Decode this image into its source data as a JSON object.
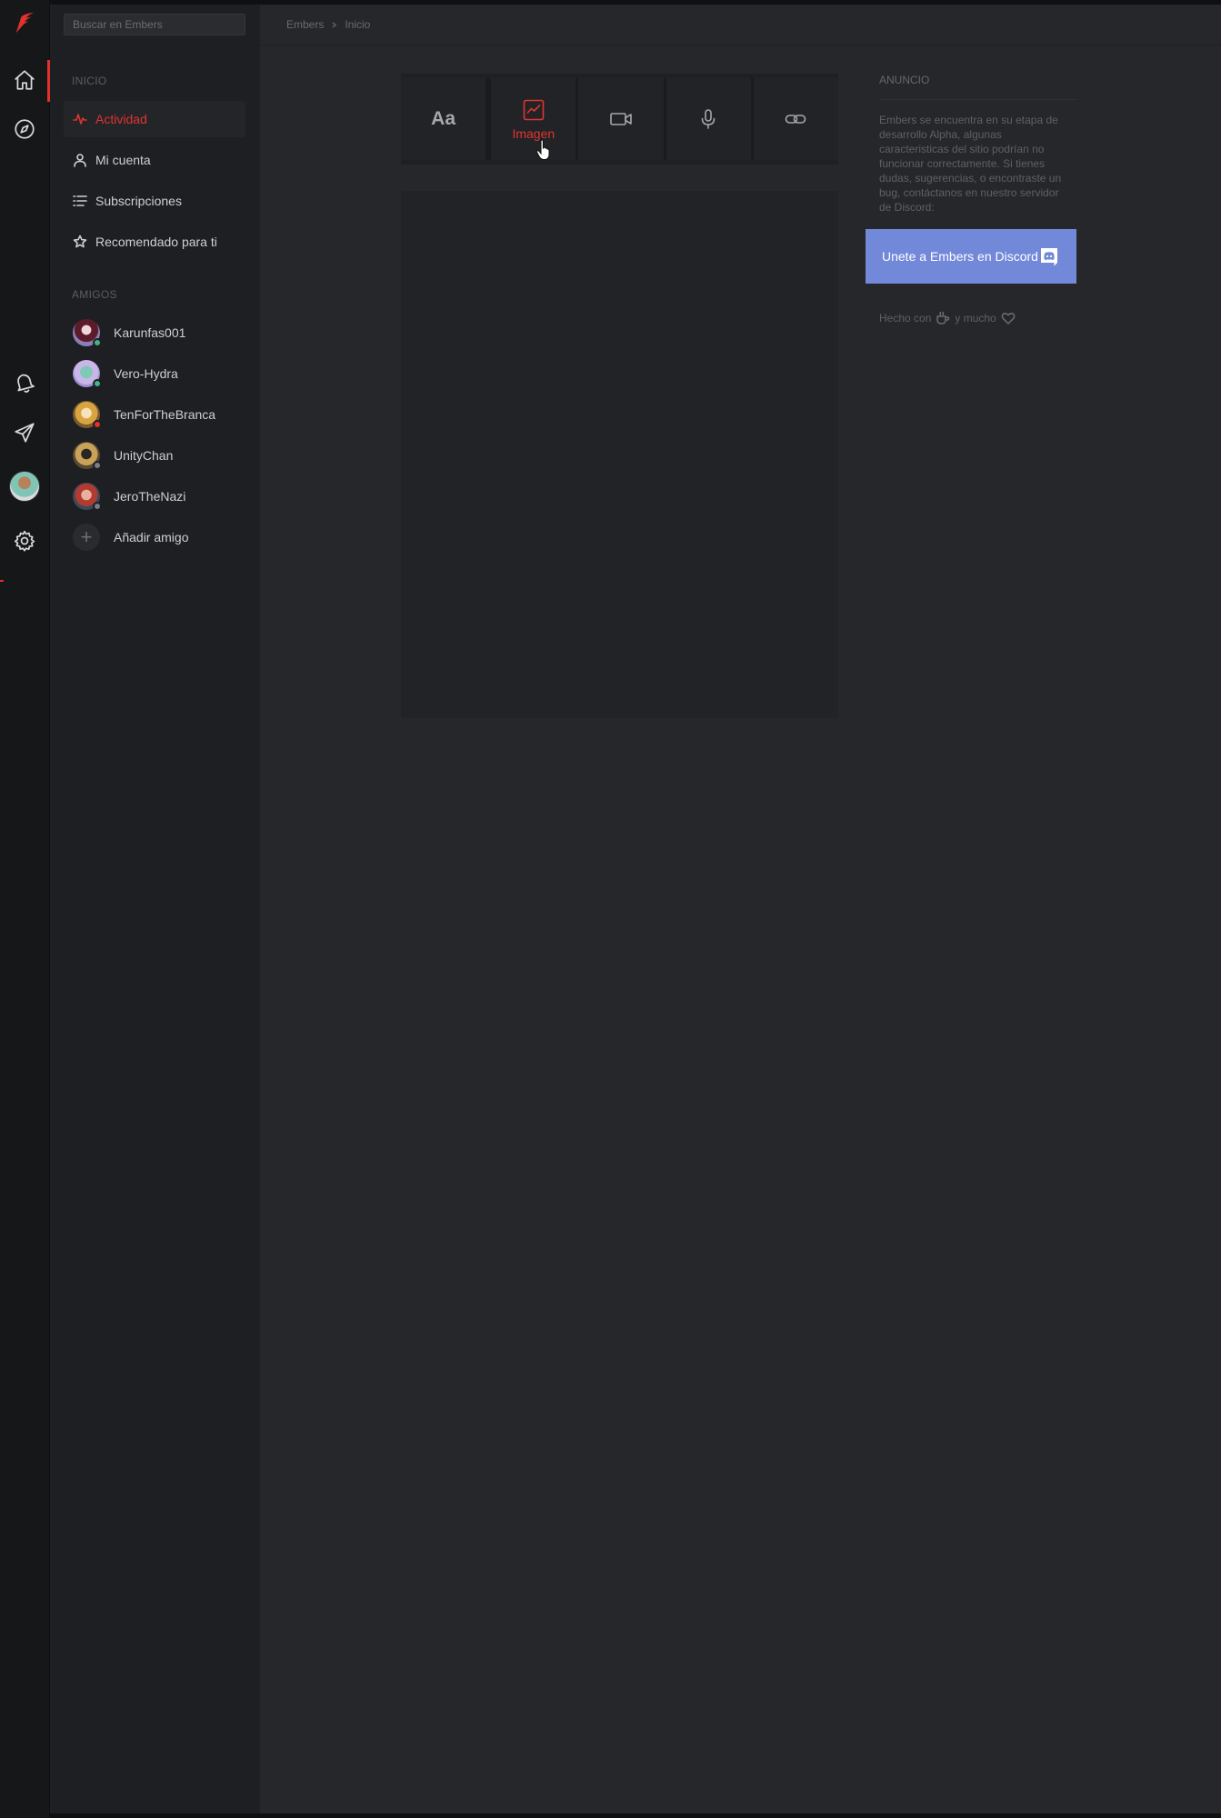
{
  "search": {
    "placeholder": "Buscar en Embers"
  },
  "sidebar": {
    "section_inicio": "INICIO",
    "nav": [
      {
        "label": "Actividad",
        "icon": "activity-icon",
        "active": true
      },
      {
        "label": "Mi cuenta",
        "icon": "user-icon"
      },
      {
        "label": "Subscripciones",
        "icon": "list-icon"
      },
      {
        "label": "Recomendado para ti",
        "icon": "star-icon"
      }
    ],
    "section_amigos": "AMIGOS",
    "friends": [
      {
        "name": "Karunfas001",
        "status": "online"
      },
      {
        "name": "Vero-Hydra",
        "status": "online"
      },
      {
        "name": "TenForTheBranca",
        "status": "busy"
      },
      {
        "name": "UnityChan",
        "status": "offline"
      },
      {
        "name": "JeroTheNazi",
        "status": "offline"
      }
    ],
    "add_friend": "Añadir amigo"
  },
  "breadcrumb": {
    "root": "Embers",
    "current": "Inicio"
  },
  "composer": {
    "text_label": "Aa",
    "image_label": "Imagen",
    "buttons": [
      "text-post",
      "image-post",
      "video-post",
      "audio-post",
      "link-post"
    ]
  },
  "aside": {
    "title": "ANUNCIO",
    "text": "Embers se encuentra en su etapa de desarrollo Alpha, algunas caracteristicas del sitio podrían no funcionar correctamente. Si tienes dudas, sugerencias, o encontraste un bug, contáctanos en nuestro servidor de Discord:",
    "discord_button": "Unete a Embers en Discord",
    "footer_prefix": "Hecho con",
    "footer_middle": "y mucho"
  },
  "colors": {
    "accent": "#e0342f",
    "discord": "#7289da",
    "status_online": "#43b581",
    "status_busy": "#e0312d",
    "status_offline": "#747f8d"
  }
}
